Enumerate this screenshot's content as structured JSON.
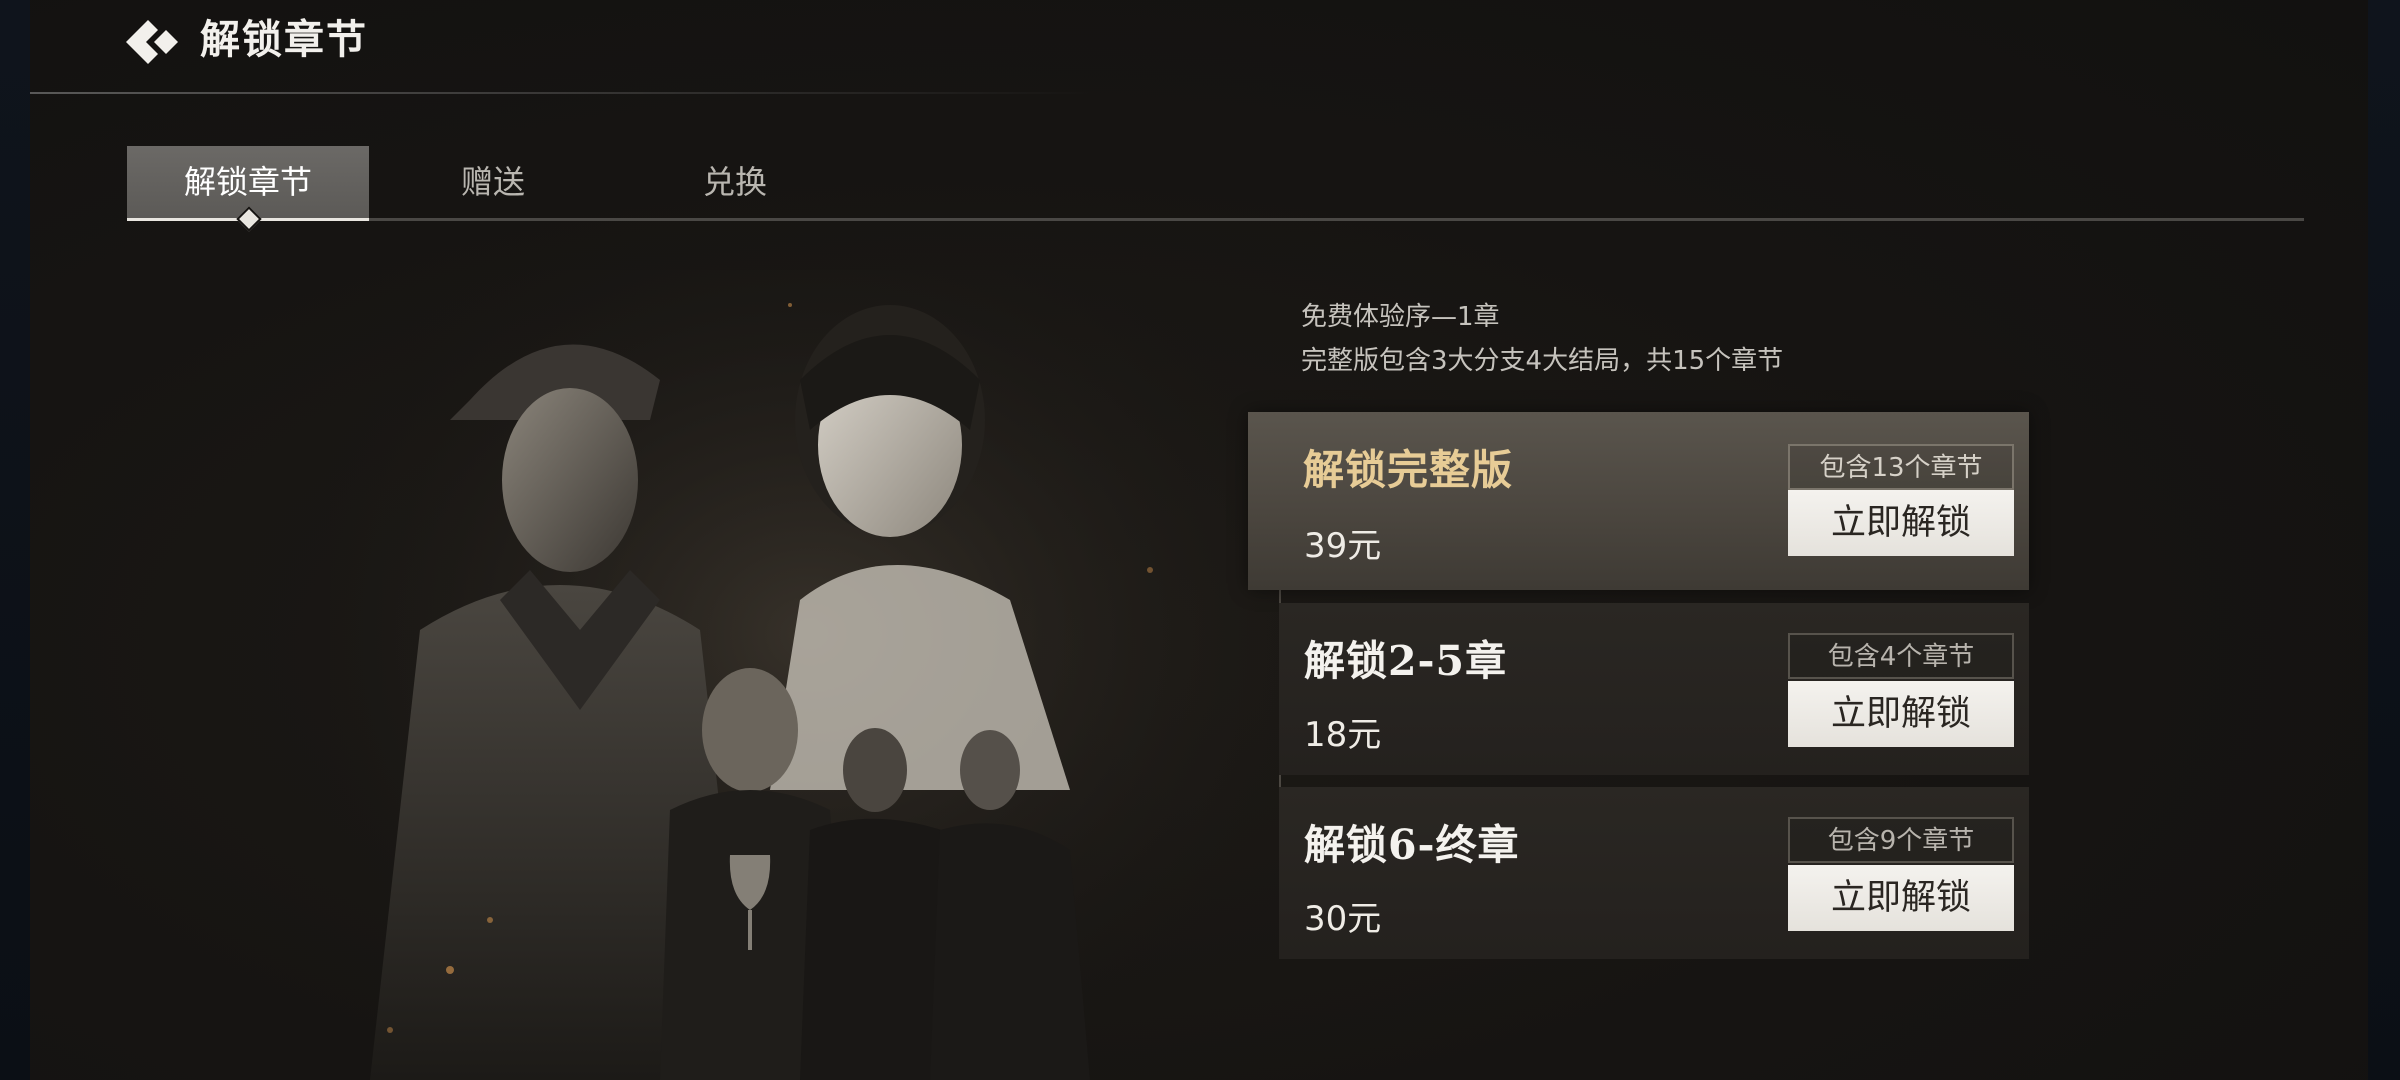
{
  "header": {
    "title": "解锁章节"
  },
  "tabs": [
    {
      "label": "解锁章节",
      "active": true
    },
    {
      "label": "赠送",
      "active": false
    },
    {
      "label": "兑换",
      "active": false
    }
  ],
  "info": {
    "line1": "免费体验序—1章",
    "line2": "完整版包含3大分支4大结局，共15个章节"
  },
  "options": [
    {
      "title": "解锁完整版",
      "price": "39元",
      "tag": "包含13个章节",
      "button": "立即解锁",
      "featured": true
    },
    {
      "title": "解锁2-5章",
      "price": "18元",
      "tag": "包含4个章节",
      "button": "立即解锁",
      "featured": false
    },
    {
      "title": "解锁6-终章",
      "price": "30元",
      "tag": "包含9个章节",
      "button": "立即解锁",
      "featured": false
    }
  ],
  "colors": {
    "background": "#161412",
    "featured_title": "#e7cc96",
    "button_bg": "#f4f2ee",
    "active_tab": "#6b6966"
  },
  "icons": {
    "back": "back-chevron-diamond-icon"
  }
}
